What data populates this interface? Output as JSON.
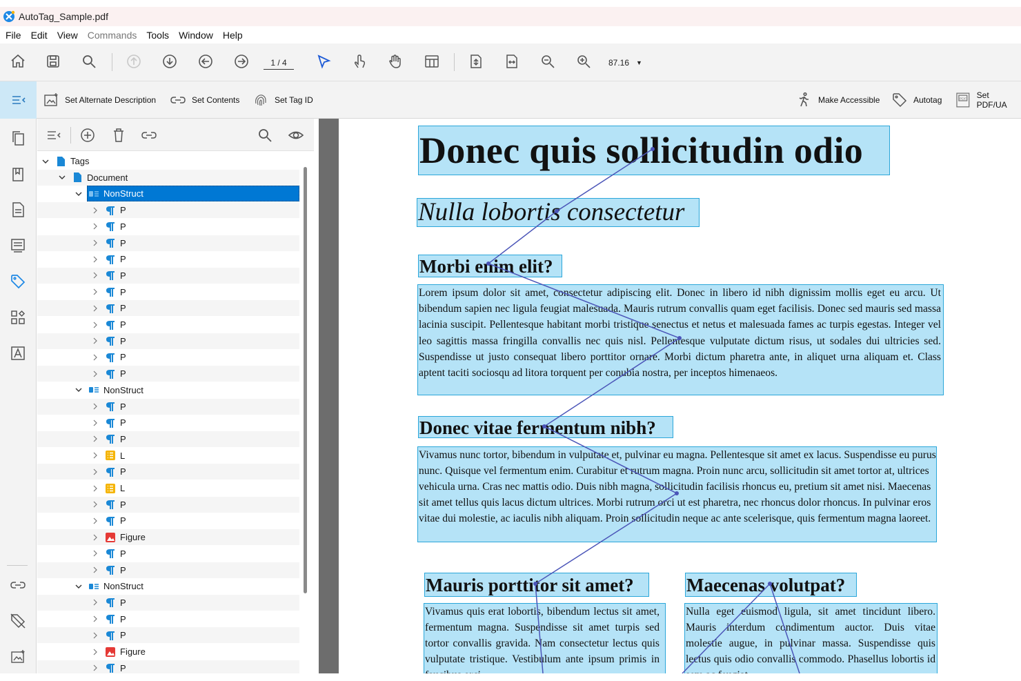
{
  "window": {
    "title": "AutoTag_Sample.pdf"
  },
  "menu": {
    "items": [
      {
        "label": "File",
        "enabled": true
      },
      {
        "label": "Edit",
        "enabled": true
      },
      {
        "label": "View",
        "enabled": true
      },
      {
        "label": "Commands",
        "enabled": false
      },
      {
        "label": "Tools",
        "enabled": true
      },
      {
        "label": "Window",
        "enabled": true
      },
      {
        "label": "Help",
        "enabled": true
      }
    ]
  },
  "toolbar": {
    "page_indicator": "1 / 4",
    "zoom": "87.16",
    "buttons": [
      "home-icon",
      "save-icon",
      "search-icon",
      "first-page-icon",
      "next-page-icon",
      "previous-page-icon",
      "forward-page-icon",
      "select-arrow-icon",
      "touch-icon",
      "hand-tool-icon",
      "layout-icon",
      "fit-page-icon",
      "fit-width-icon",
      "zoom-out-icon",
      "zoom-in-icon"
    ]
  },
  "accessibility_toolbar": {
    "set_alt_description": "Set Alternate Description",
    "set_contents": "Set Contents",
    "set_tag_id": "Set Tag ID",
    "make_accessible": "Make Accessible",
    "autotag": "Autotag",
    "set_pdfua": "Set PDF/UA"
  },
  "tags_tree": {
    "root": "Tags",
    "document": "Document",
    "groups": [
      {
        "label": "NonStruct",
        "selected": true,
        "children": [
          "P",
          "P",
          "P",
          "P",
          "P",
          "P",
          "P",
          "P",
          "P",
          "P",
          "P"
        ]
      },
      {
        "label": "NonStruct",
        "selected": false,
        "children": [
          "P",
          "P",
          "P",
          "L",
          "P",
          "L",
          "P",
          "P",
          "Figure",
          "P",
          "P"
        ]
      },
      {
        "label": "NonStruct",
        "selected": false,
        "children": [
          "P",
          "P",
          "P",
          "Figure",
          "P"
        ]
      }
    ]
  },
  "document": {
    "title": "Donec quis sollicitudin odio",
    "subtitle": "Nulla lobortis consectetur",
    "heading1": "Morbi enim elit?",
    "para1": "Lorem ipsum dolor sit amet, consectetur adipiscing elit. Donec in libero id nibh dignissim mollis eget eu arcu. Ut bibendum sapien nec ligula feugiat malesuada. Mauris rutrum convallis quam eget facilisis. Donec sed mauris sed massa lacinia suscipit. Pellentesque habitant morbi tristique senectus et netus et malesuada fames ac turpis egestas. Integer vel leo sagittis massa fringilla convallis nec quis nisl. Pellentesque vulputate dictum risus, ut sodales dui ultricies sed. Suspendisse ut justo consequat libero porttitor ornare. Morbi dictum pharetra ante, in aliquet urna aliquam et. Class aptent taciti sociosqu ad litora torquent per conubia nostra, per inceptos himenaeos.",
    "heading2": "Donec vitae fermentum nibh?",
    "para2": "Vivamus nunc tortor, bibendum in vulputate et, pulvinar eu magna. Pellentesque sit amet ex lacus. Suspendisse eu purus nunc. Quisque vel fermentum enim. Curabitur et rutrum magna. Proin nunc arcu, sollicitudin sit amet tortor at, ultrices vehicula urna. Cras nec mattis odio. Duis nibh magna, sollicitudin facilisis rhoncus eu, pretium sit amet nisi. Maecenas sit amet tellus quis lacus dictum ultrices. Morbi rutrum orci ut est pharetra, nec rhoncus dolor rhoncus. In pulvinar eros vitae dui molestie, ac iaculis nibh aliquam. Proin sollicitudin neque ac ante scelerisque, quis fermentum magna laoreet.",
    "heading3": "Mauris porttitor sit amet?",
    "para3": "Vivamus quis erat lobortis, bibendum lectus sit amet, fermentum magna. Suspendisse sit amet turpis sed tortor convallis gravida. Nam consectetur lectus quis vulputate tristique. Vestibulum ante ipsum primis in faucibus orci",
    "heading4": "Maecenas volutpat?",
    "para4": "Nulla eget euismod ligula, sit amet tincidunt libero. Mauris interdum condimentum auctor. Duis vitae molestie augue, in pulvinar massa. Suspendisse quis lectus quis odio convallis commodo. Phasellus lobortis id sem ac feugiat."
  },
  "colors": {
    "highlight_fill": "#b5e3f7",
    "highlight_border": "#2aa6d9",
    "reading_order_line": "#4b55b8",
    "selection": "#0078d4",
    "tag_icon_blue": "#1a88d6",
    "list_icon": "#f5b400",
    "figure_icon": "#e53935"
  }
}
